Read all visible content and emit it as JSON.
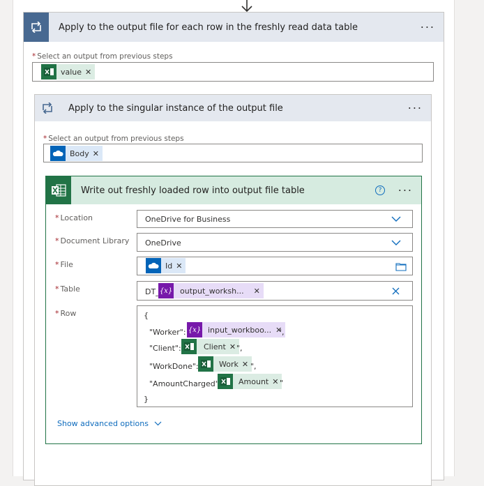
{
  "outer_loop": {
    "title": "Apply to the output file for each row in the freshly read data table",
    "more": "···",
    "select_label": "Select an output from previous steps",
    "token": "value"
  },
  "inner_loop": {
    "title": "Apply to the singular instance of the output file",
    "more": "···",
    "select_label": "Select an output from previous steps",
    "token": "Body"
  },
  "action": {
    "title": "Write out freshly loaded row into output file table",
    "help": "?",
    "more": "···",
    "location": {
      "label": "Location",
      "value": "OneDrive for Business"
    },
    "library": {
      "label": "Document Library",
      "value": "OneDrive"
    },
    "file": {
      "label": "File",
      "token": "Id"
    },
    "table": {
      "label": "Table",
      "prefix": "DT_",
      "token": "output_worksh..."
    },
    "row": {
      "label": "Row",
      "open": "{",
      "close": "}",
      "lines": [
        {
          "key": "\"Worker\": \"",
          "token": "input_workboo...",
          "suffix": "\","
        },
        {
          "key": "\"Client\": \"",
          "token": "Client",
          "suffix": "\","
        },
        {
          "key": "\"WorkDone\": \"",
          "token": "Work",
          "suffix": "\","
        },
        {
          "key": "\"AmountCharged\": \"",
          "token": "Amount",
          "suffix": "\""
        }
      ]
    },
    "advanced": "Show advanced options"
  },
  "colors": {
    "loop_header": "#e4e8ef",
    "action_header": "#d6ebe0",
    "excel": "#217346",
    "onedrive": "#0364b8",
    "expression": "#7719aa",
    "link": "#0f6cbd"
  }
}
